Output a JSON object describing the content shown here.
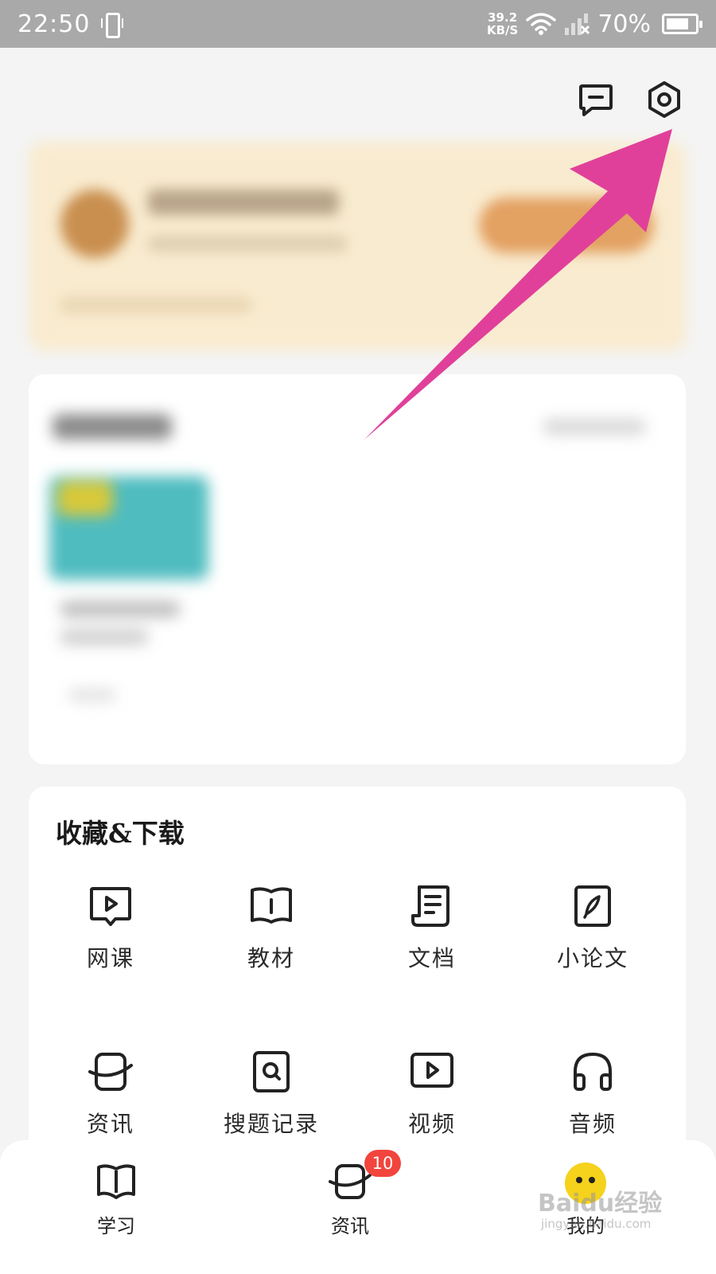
{
  "status_bar": {
    "time": "22:50",
    "net_speed_value": "39.2",
    "net_speed_unit": "KB/S",
    "battery": "70%"
  },
  "header": {
    "icons": [
      "message-icon",
      "settings-icon"
    ]
  },
  "favorites": {
    "title": "收藏&下载",
    "items": [
      {
        "label": "网课",
        "icon": "video-course-icon"
      },
      {
        "label": "教材",
        "icon": "textbook-icon"
      },
      {
        "label": "文档",
        "icon": "document-icon"
      },
      {
        "label": "小论文",
        "icon": "paper-icon"
      },
      {
        "label": "资讯",
        "icon": "news-icon"
      },
      {
        "label": "搜题记录",
        "icon": "search-history-icon"
      },
      {
        "label": "视频",
        "icon": "video-icon"
      },
      {
        "label": "音频",
        "icon": "audio-icon"
      }
    ]
  },
  "bottom_nav": {
    "items": [
      {
        "label": "学习",
        "icon": "book-icon"
      },
      {
        "label": "资讯",
        "icon": "news-icon",
        "badge": "10"
      },
      {
        "label": "我的",
        "icon": "profile-face-icon"
      }
    ]
  },
  "watermark": {
    "text": "Baidu经验",
    "url": "jingyan.baidu.com"
  },
  "colors": {
    "status_bar": "#a9a9a9",
    "badge": "#f1453d",
    "arrow": "#e0409a",
    "profile_card": "#f9ebcf"
  }
}
